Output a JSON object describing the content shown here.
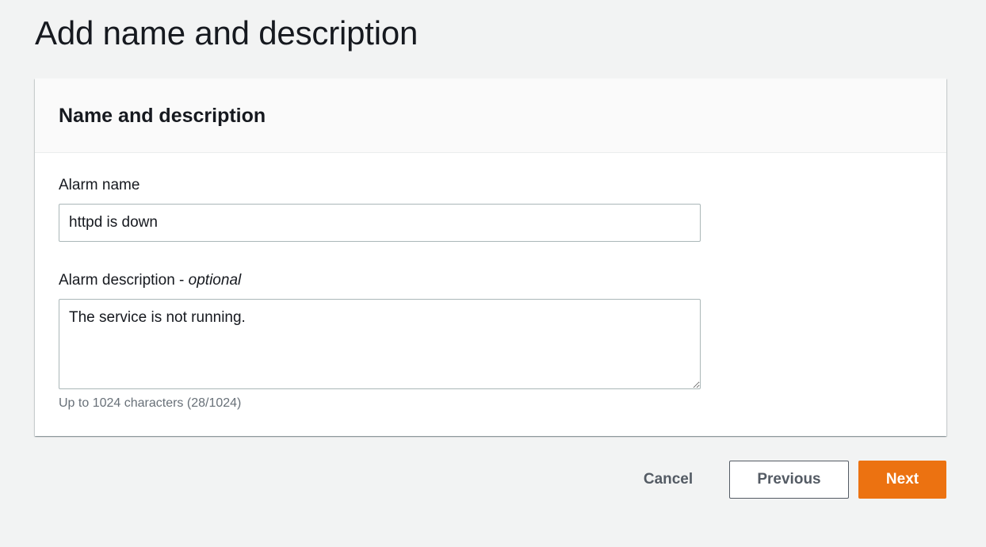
{
  "page": {
    "title": "Add name and description"
  },
  "panel": {
    "title": "Name and description",
    "alarm_name": {
      "label": "Alarm name",
      "value": "httpd is down"
    },
    "alarm_description": {
      "label": "Alarm description - ",
      "optional_label": "optional",
      "value": "The service is not running.",
      "hint": "Up to 1024 characters (28/1024)"
    }
  },
  "actions": {
    "cancel_label": "Cancel",
    "previous_label": "Previous",
    "next_label": "Next"
  },
  "colors": {
    "primary_button": "#ec7211",
    "background": "#f2f3f3"
  }
}
